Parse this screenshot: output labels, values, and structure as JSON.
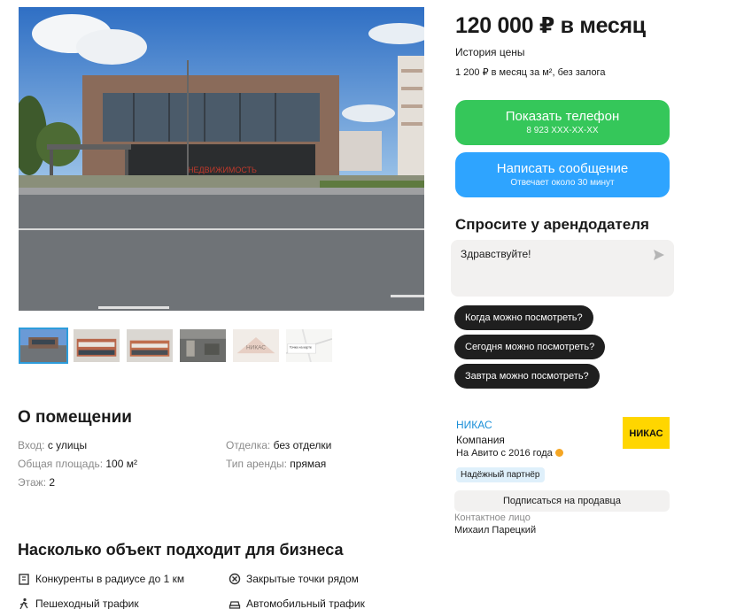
{
  "listing": {
    "price": "120 000 ₽ в месяц",
    "price_history": "История цены",
    "price_details": "1 200 ₽ в месяц за м², без залога"
  },
  "gallery": {
    "main_watermark": "НЕДВИЖИМОСТЬ",
    "thumb_map_title": "Точка на карте"
  },
  "actions": {
    "phone_label": "Показать телефон",
    "phone_number": "8 923 XXX-XX-XX",
    "message_label": "Написать сообщение",
    "message_sub": "Отвечает около 30 минут"
  },
  "ask": {
    "title": "Спросите у арендодателя",
    "input_value": "Здравствуйте!",
    "quick_questions": [
      "Когда можно посмотреть?",
      "Сегодня можно посмотреть?",
      "Завтра можно посмотреть?"
    ]
  },
  "seller": {
    "name": "НИКАС",
    "type": "Компания",
    "since": "На Авито с 2016 года",
    "badge": "Надёжный партнёр",
    "logo_text": "НИКАС",
    "subscribe": "Подписаться на продавца",
    "contact_label": "Контактное лицо",
    "contact_name": "Михаил Парецкий"
  },
  "about": {
    "title": "О помещении",
    "attributes": [
      {
        "key": "Вход:",
        "value": "с улицы"
      },
      {
        "key": "Общая площадь:",
        "value": "100 м²"
      },
      {
        "key": "Этаж:",
        "value": "2"
      },
      {
        "key": "Отделка:",
        "value": "без отделки"
      },
      {
        "key": "Тип аренды:",
        "value": "прямая"
      }
    ]
  },
  "business": {
    "title": "Насколько объект подходит для бизнеса",
    "items": [
      {
        "label": "Конкуренты в радиусе до 1 км",
        "icon": "building-icon"
      },
      {
        "label": "Закрытые точки рядом",
        "icon": "closed-circle-icon"
      },
      {
        "label": "Пешеходный трафик",
        "icon": "walking-icon"
      },
      {
        "label": "Автомобильный трафик",
        "icon": "car-icon"
      }
    ]
  },
  "colors": {
    "phone_button": "#35c75a",
    "message_button": "#2ea4ff",
    "chip": "#1f1f1f",
    "seller_link": "#1a8fd8",
    "logo_bg": "#ffd600"
  }
}
